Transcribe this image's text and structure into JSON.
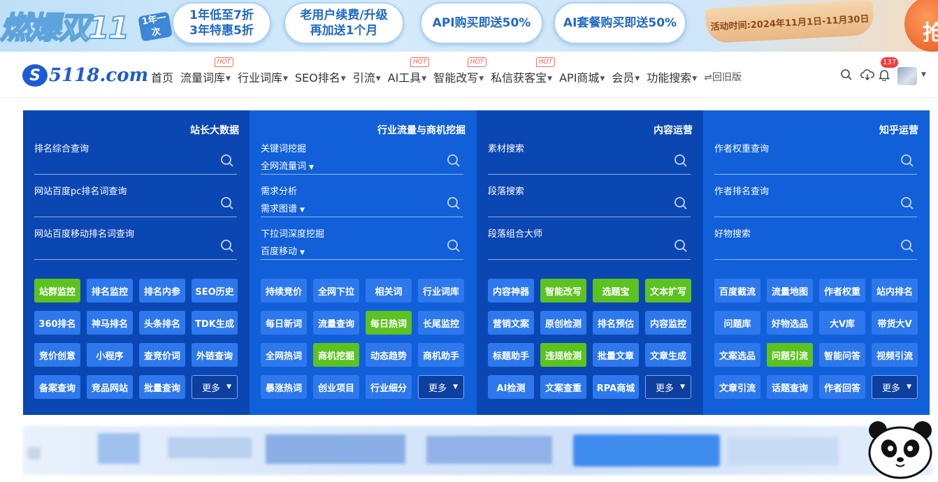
{
  "banner": {
    "logo": "燃爆双11",
    "badge": "1年一次",
    "pills": [
      {
        "line1": "1年低至7折",
        "line2": "3年特惠5折"
      },
      {
        "line1": "老用户续费/升级",
        "line2": "再加送1个月"
      },
      {
        "line1": "API购买即送50%",
        "line2": ""
      },
      {
        "line1": "AI套餐购买即送50%",
        "line2": ""
      }
    ],
    "activity": "活动时间:2024年11月1日-11月30日",
    "grab": "抢"
  },
  "nav": {
    "logo_text": "5118.com",
    "menu": [
      {
        "label": "首页",
        "caret": false,
        "hot": false
      },
      {
        "label": "流量词库",
        "caret": true,
        "hot": true
      },
      {
        "label": "行业词库",
        "caret": true,
        "hot": false
      },
      {
        "label": "SEO排名",
        "caret": true,
        "hot": false
      },
      {
        "label": "引流",
        "caret": true,
        "hot": false
      },
      {
        "label": "AI工具",
        "caret": true,
        "hot": true
      },
      {
        "label": "智能改写",
        "caret": true,
        "hot": true
      },
      {
        "label": "私信获客宝",
        "caret": true,
        "hot": true
      },
      {
        "label": "API商城",
        "caret": true,
        "hot": false
      },
      {
        "label": "会员",
        "caret": true,
        "hot": false
      },
      {
        "label": "功能搜索",
        "caret": true,
        "hot": false
      }
    ],
    "old_version": "⇌回旧版",
    "hot_label": "HOT",
    "notification_count": "137"
  },
  "panels": [
    {
      "title": "站长大数据",
      "fields": [
        {
          "label": "排名综合查询",
          "select": ""
        },
        {
          "label": "网站百度pc排名词查询",
          "select": ""
        },
        {
          "label": "网站百度移动排名词查询",
          "select": ""
        }
      ],
      "buttons": [
        {
          "label": "站群监控",
          "green": true
        },
        {
          "label": "排名监控",
          "green": false
        },
        {
          "label": "排名内参",
          "green": false
        },
        {
          "label": "SEO历史",
          "green": false
        },
        {
          "label": "360排名",
          "green": false
        },
        {
          "label": "神马排名",
          "green": false
        },
        {
          "label": "头条排名",
          "green": false
        },
        {
          "label": "TDK生成",
          "green": false
        },
        {
          "label": "竞价创意",
          "green": false
        },
        {
          "label": "小程序",
          "green": false
        },
        {
          "label": "查竞价词",
          "green": false
        },
        {
          "label": "外链查询",
          "green": false
        },
        {
          "label": "备案查询",
          "green": false
        },
        {
          "label": "竞品网站",
          "green": false
        },
        {
          "label": "批量查询",
          "green": false
        },
        {
          "label": "更多",
          "green": false,
          "more": true
        }
      ]
    },
    {
      "title": "行业流量与商机挖掘",
      "fields": [
        {
          "label": "关键词挖掘",
          "select": "全网流量词"
        },
        {
          "label": "需求分析",
          "select": "需求图谱"
        },
        {
          "label": "下拉词深度挖掘",
          "select": "百度移动"
        }
      ],
      "buttons": [
        {
          "label": "持续竞价",
          "green": false
        },
        {
          "label": "全网下拉",
          "green": false
        },
        {
          "label": "相关词",
          "green": false
        },
        {
          "label": "行业词库",
          "green": false
        },
        {
          "label": "每日新词",
          "green": false
        },
        {
          "label": "流量查询",
          "green": false
        },
        {
          "label": "每日热词",
          "green": true
        },
        {
          "label": "长尾监控",
          "green": false
        },
        {
          "label": "全网热词",
          "green": false
        },
        {
          "label": "商机挖掘",
          "green": true
        },
        {
          "label": "动态趋势",
          "green": false
        },
        {
          "label": "商机助手",
          "green": false
        },
        {
          "label": "暴涨热词",
          "green": false
        },
        {
          "label": "创业项目",
          "green": false
        },
        {
          "label": "行业细分",
          "green": false
        },
        {
          "label": "更多",
          "green": false,
          "more": true
        }
      ]
    },
    {
      "title": "内容运营",
      "fields": [
        {
          "label": "素材搜索",
          "select": ""
        },
        {
          "label": "段落搜索",
          "select": ""
        },
        {
          "label": "段落组合大师",
          "select": ""
        }
      ],
      "buttons": [
        {
          "label": "内容神器",
          "green": false
        },
        {
          "label": "智能改写",
          "green": true
        },
        {
          "label": "选题宝",
          "green": true
        },
        {
          "label": "文本扩写",
          "green": true
        },
        {
          "label": "营销文案",
          "green": false
        },
        {
          "label": "原创检测",
          "green": false
        },
        {
          "label": "排名预估",
          "green": false
        },
        {
          "label": "内容监控",
          "green": false
        },
        {
          "label": "标题助手",
          "green": false
        },
        {
          "label": "违规检测",
          "green": true
        },
        {
          "label": "批量文章",
          "green": false
        },
        {
          "label": "文章生成",
          "green": false
        },
        {
          "label": "AI检测",
          "green": false
        },
        {
          "label": "文案查重",
          "green": false
        },
        {
          "label": "RPA商城",
          "green": false
        },
        {
          "label": "更多",
          "green": false,
          "more": true
        }
      ]
    },
    {
      "title": "知乎运营",
      "fields": [
        {
          "label": "作者权重查询",
          "select": ""
        },
        {
          "label": "作者排名查询",
          "select": ""
        },
        {
          "label": "好物搜索",
          "select": ""
        }
      ],
      "buttons": [
        {
          "label": "百度截流",
          "green": false
        },
        {
          "label": "流量地图",
          "green": false
        },
        {
          "label": "作者权重",
          "green": false
        },
        {
          "label": "站内排名",
          "green": false
        },
        {
          "label": "问题库",
          "green": false
        },
        {
          "label": "好物选品",
          "green": false
        },
        {
          "label": "大V库",
          "green": false
        },
        {
          "label": "带货大V",
          "green": false
        },
        {
          "label": "文案选品",
          "green": false
        },
        {
          "label": "问题引流",
          "green": true
        },
        {
          "label": "智能问答",
          "green": false
        },
        {
          "label": "视频引流",
          "green": false
        },
        {
          "label": "文章引流",
          "green": false
        },
        {
          "label": "话题查询",
          "green": false
        },
        {
          "label": "作者回答",
          "green": false
        },
        {
          "label": "更多",
          "green": false,
          "more": true
        }
      ]
    }
  ],
  "colors": {
    "panel_dark": "#0b47b3",
    "panel_light": "#1160d9",
    "button": "#2d78ec",
    "button_green": "#5bc21f",
    "brand": "#1d5bd6"
  }
}
